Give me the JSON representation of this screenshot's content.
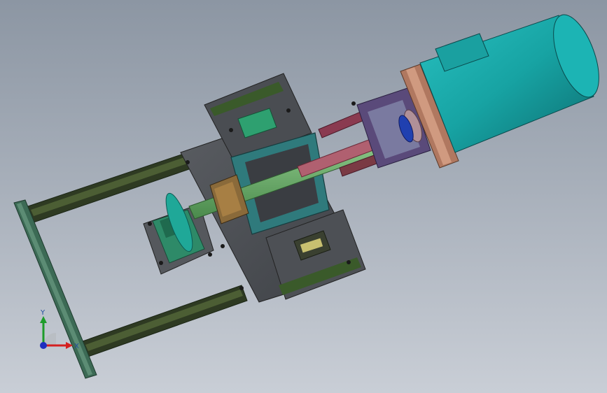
{
  "viewport": {
    "background_top": "#8c96a3",
    "background_bottom": "#c9ced6"
  },
  "triad": {
    "x_label": "X",
    "y_label": "Y",
    "x_color": "#d42020",
    "y_color": "#1e9c2a",
    "z_color": "#1f2fbf"
  },
  "colors": {
    "motor": "#17a3a3",
    "plate": "#4a4d52",
    "rail": "#3a4a2a",
    "shaft": "#5fa060",
    "frame": "#3c6a55",
    "rod": "#b06070"
  }
}
